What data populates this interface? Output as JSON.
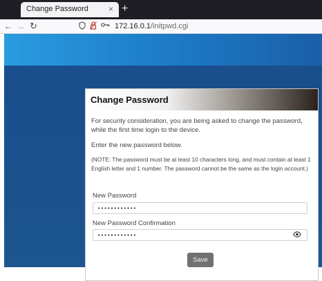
{
  "browser": {
    "tab": {
      "title": "Change Password",
      "close_glyph": "×"
    },
    "new_tab_glyph": "+",
    "nav": {
      "back_glyph": "←",
      "forward_glyph": "→",
      "reload_glyph": "↻"
    },
    "address": {
      "host": "172.16.0.1",
      "path": "/initpwd.cgi"
    }
  },
  "dialog": {
    "title": "Change Password",
    "intro": "For security consideration, you are being asked to change the password, while the first time login to the device.",
    "enter_prompt": "Enter the new password below.",
    "note": "(NOTE: The password must be at least 10 characters long, and must contain at least 1 English letter and 1 number. The password cannot be the same as the login account.)",
    "new_password_label": "New Password",
    "new_password_value": "••••••••••••",
    "confirm_label": "New Password Confirmation",
    "confirm_value": "••••••••••••",
    "save_label": "Save"
  },
  "icons": {
    "shield": "shield-icon",
    "lock": "lock-warning-icon",
    "key": "key-icon",
    "eye": "eye-icon"
  },
  "colors": {
    "banner_blue": "#2a9ce0",
    "page_navy": "#1a4e8c",
    "save_button": "#717171",
    "lock_warning": "#c0392b"
  }
}
